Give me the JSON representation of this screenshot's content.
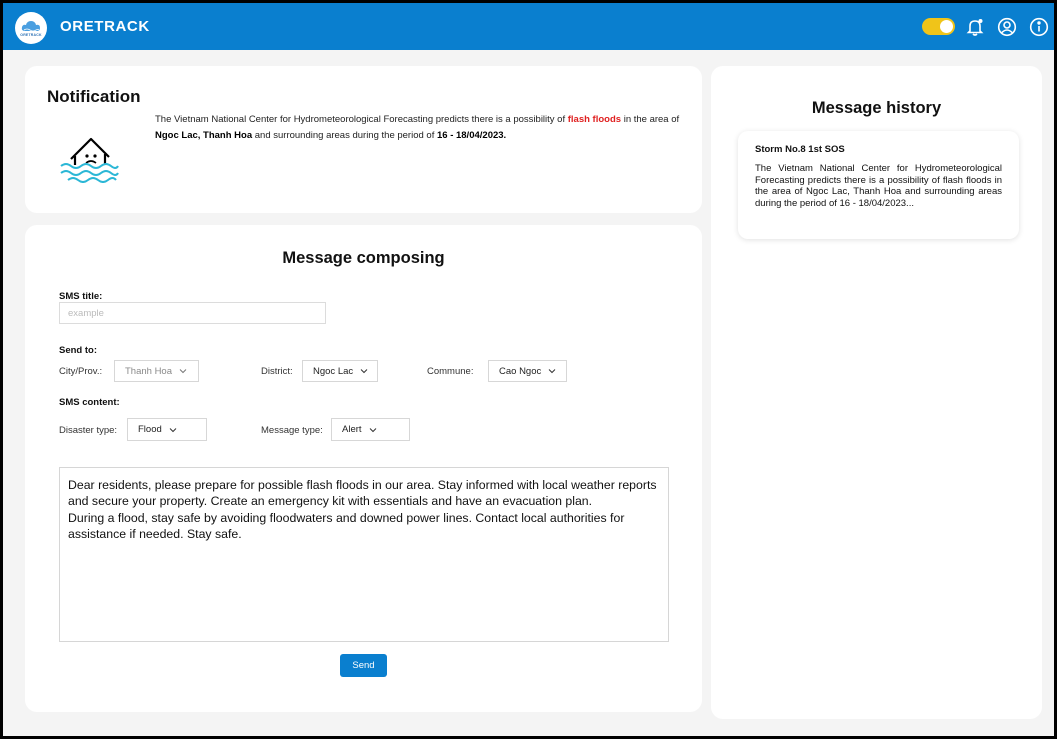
{
  "header": {
    "logo_text": "ORETRACK",
    "brand": "ORETRACK",
    "icons": [
      "toggle-switch",
      "bell-icon",
      "user-icon",
      "info-icon"
    ],
    "colors": {
      "primary": "#0a7fcf",
      "toggle": "#f0c419",
      "highlight": "#e02020"
    }
  },
  "notification": {
    "title": "Notification",
    "icon": "flooded-house-icon",
    "text_before": "The Vietnam National Center for Hydrometeorological Forecasting predicts there is a possibility of ",
    "highlight": "flash floods",
    "text_mid": " in the area of ",
    "location": "Ngoc Lac, Thanh Hoa",
    "text_mid2": " and surrounding areas during the period of ",
    "period": "16 - 18/04/2023."
  },
  "compose": {
    "title": "Message composing",
    "sms_title_label": "SMS title:",
    "sms_title_placeholder": "example",
    "send_to_label": "Send to:",
    "city_label": "City/Prov.:",
    "city_value": "Thanh Hoa",
    "district_label": "District:",
    "district_value": "Ngoc Lac",
    "commune_label": "Commune:",
    "commune_value": "Cao Ngoc",
    "sms_content_label": "SMS content:",
    "disaster_label": "Disaster type:",
    "disaster_value": "Flood",
    "message_type_label": "Message type:",
    "message_type_value": "Alert",
    "content": "Dear residents, please prepare for possible flash floods in our area. Stay informed with local weather reports and secure your property. Create an emergency kit with essentials and have an evacuation plan.\nDuring a flood, stay safe by avoiding floodwaters and downed power lines. Contact local authorities for assistance if needed. Stay safe.",
    "send_label": "Send"
  },
  "history": {
    "title": "Message history",
    "items": [
      {
        "title": "Storm No.8 1st SOS",
        "body": "The Vietnam National Center for Hydrometeorological Forecasting predicts there is a possibility of flash floods in the area of Ngoc Lac, Thanh Hoa and surrounding areas during the period of 16 - 18/04/2023..."
      }
    ]
  }
}
